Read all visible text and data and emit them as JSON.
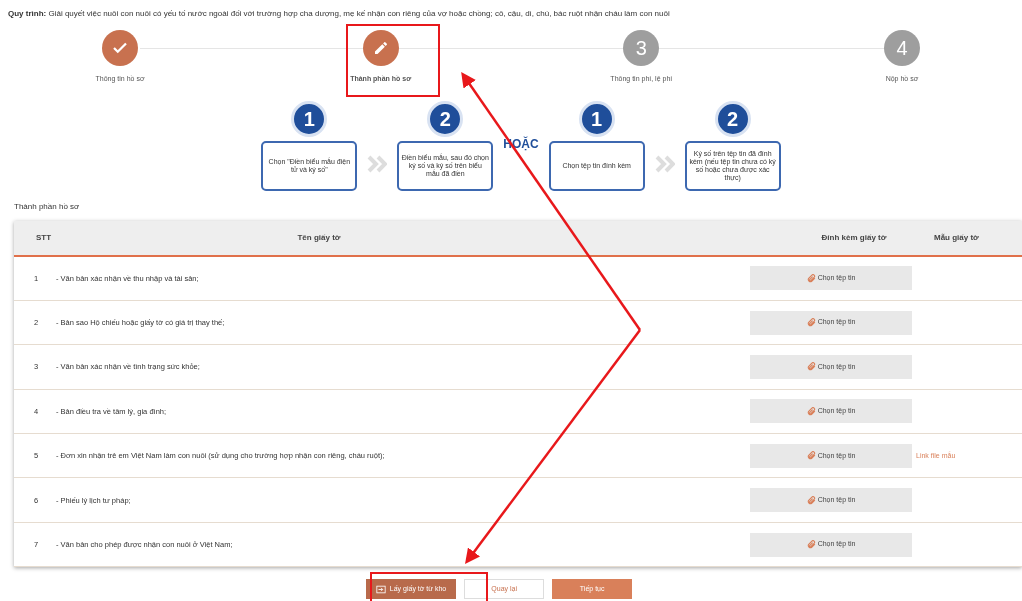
{
  "procedure": {
    "label": "Quy trình:",
    "text": "Giải quyết việc nuôi con nuôi có yếu tố nước ngoài đối với trường hợp cha dượng, mẹ kế nhận con riêng của vợ hoặc chồng; cô, cậu, dì, chú, bác ruột nhận cháu làm con nuôi"
  },
  "steps": [
    {
      "label": "Thông tin hồ sơ",
      "kind": "done",
      "selected": false
    },
    {
      "label": "Thành phần hồ sơ",
      "kind": "current",
      "selected": true
    },
    {
      "number": "3",
      "label": "Thông tin phí, lệ phí",
      "kind": "pending",
      "selected": false
    },
    {
      "number": "4",
      "label": "Nộp hồ sơ",
      "kind": "pending",
      "selected": false
    }
  ],
  "guide": {
    "separator": "HOẶC",
    "groups": [
      [
        {
          "number": "1",
          "text": "Chọn \"Điền biểu mẫu điện tử và ký số\""
        },
        {
          "number": "2",
          "text": "Điền biểu mẫu, sau đó chọn ký số và ký số trên biểu mẫu đã điền"
        }
      ],
      [
        {
          "number": "1",
          "text": "Chọn tệp tin đính kèm"
        },
        {
          "number": "2",
          "text": "Ký số trên tệp tin đã đính kèm (nếu tệp tin chưa có ký số hoặc chưa được xác thực)"
        }
      ]
    ]
  },
  "section_title": "Thành phần hồ sơ",
  "table": {
    "columns": [
      "STT",
      "Tên giấy tờ",
      "Đính kèm giấy tờ",
      "Mẫu giấy tờ"
    ],
    "rows": [
      {
        "stt": "1",
        "name": "- Văn bản xác nhận về thu nhập và tài sản;",
        "attach": "Chọn tệp tin"
      },
      {
        "stt": "2",
        "name": "- Bản sao Hộ chiếu hoặc giấy tờ có giá trị thay thế;",
        "attach": "Chọn tệp tin"
      },
      {
        "stt": "3",
        "name": "- Văn bản xác nhận về tình trạng sức khỏe;",
        "attach": "Chọn tệp tin"
      },
      {
        "stt": "4",
        "name": "- Bản điều tra về tâm lý, gia đình;",
        "attach": "Chọn tệp tin"
      },
      {
        "stt": "5",
        "name": "- Đơn xin nhận trẻ em Việt Nam làm con nuôi (sử dụng cho trường hợp nhận con riêng, cháu ruột);",
        "attach": "Chọn tệp tin",
        "template": "Link file mẫu"
      },
      {
        "stt": "6",
        "name": "- Phiếu lý lịch tư pháp;",
        "attach": "Chọn tệp tin"
      },
      {
        "stt": "7",
        "name": "- Văn bản cho phép được nhận con nuôi ở Việt Nam;",
        "attach": "Chọn tệp tin"
      }
    ]
  },
  "buttons": [
    {
      "label": "Lấy giấy tờ từ kho",
      "kind": "primary"
    },
    {
      "label": "Quay lại",
      "kind": "outline"
    },
    {
      "label": "Tiếp tục",
      "kind": "accent"
    }
  ]
}
